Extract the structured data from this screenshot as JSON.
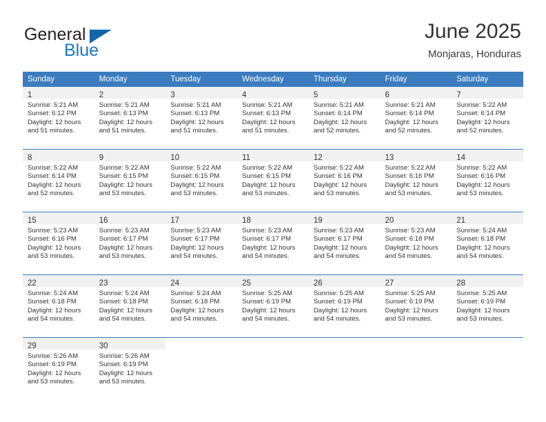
{
  "brand": {
    "name_part1": "General",
    "name_part2": "Blue",
    "triangle_color": "#1565ad",
    "blue_color": "#1b76c4"
  },
  "header": {
    "title": "June 2025",
    "location": "Monjaras, Honduras"
  },
  "theme": {
    "header_bg": "#3a7cbe",
    "daynum_bg": "#f1f1f1",
    "divider": "#3a7cbe",
    "text": "#333333"
  },
  "weekday_headers": [
    "Sunday",
    "Monday",
    "Tuesday",
    "Wednesday",
    "Thursday",
    "Friday",
    "Saturday"
  ],
  "weeks": [
    [
      {
        "day": "1",
        "sunrise": "Sunrise: 5:21 AM",
        "sunset": "Sunset: 6:12 PM",
        "daylight_line1": "Daylight: 12 hours",
        "daylight_line2": "and 51 minutes."
      },
      {
        "day": "2",
        "sunrise": "Sunrise: 5:21 AM",
        "sunset": "Sunset: 6:13 PM",
        "daylight_line1": "Daylight: 12 hours",
        "daylight_line2": "and 51 minutes."
      },
      {
        "day": "3",
        "sunrise": "Sunrise: 5:21 AM",
        "sunset": "Sunset: 6:13 PM",
        "daylight_line1": "Daylight: 12 hours",
        "daylight_line2": "and 51 minutes."
      },
      {
        "day": "4",
        "sunrise": "Sunrise: 5:21 AM",
        "sunset": "Sunset: 6:13 PM",
        "daylight_line1": "Daylight: 12 hours",
        "daylight_line2": "and 51 minutes."
      },
      {
        "day": "5",
        "sunrise": "Sunrise: 5:21 AM",
        "sunset": "Sunset: 6:14 PM",
        "daylight_line1": "Daylight: 12 hours",
        "daylight_line2": "and 52 minutes."
      },
      {
        "day": "6",
        "sunrise": "Sunrise: 5:21 AM",
        "sunset": "Sunset: 6:14 PM",
        "daylight_line1": "Daylight: 12 hours",
        "daylight_line2": "and 52 minutes."
      },
      {
        "day": "7",
        "sunrise": "Sunrise: 5:22 AM",
        "sunset": "Sunset: 6:14 PM",
        "daylight_line1": "Daylight: 12 hours",
        "daylight_line2": "and 52 minutes."
      }
    ],
    [
      {
        "day": "8",
        "sunrise": "Sunrise: 5:22 AM",
        "sunset": "Sunset: 6:14 PM",
        "daylight_line1": "Daylight: 12 hours",
        "daylight_line2": "and 52 minutes."
      },
      {
        "day": "9",
        "sunrise": "Sunrise: 5:22 AM",
        "sunset": "Sunset: 6:15 PM",
        "daylight_line1": "Daylight: 12 hours",
        "daylight_line2": "and 53 minutes."
      },
      {
        "day": "10",
        "sunrise": "Sunrise: 5:22 AM",
        "sunset": "Sunset: 6:15 PM",
        "daylight_line1": "Daylight: 12 hours",
        "daylight_line2": "and 53 minutes."
      },
      {
        "day": "11",
        "sunrise": "Sunrise: 5:22 AM",
        "sunset": "Sunset: 6:15 PM",
        "daylight_line1": "Daylight: 12 hours",
        "daylight_line2": "and 53 minutes."
      },
      {
        "day": "12",
        "sunrise": "Sunrise: 5:22 AM",
        "sunset": "Sunset: 6:16 PM",
        "daylight_line1": "Daylight: 12 hours",
        "daylight_line2": "and 53 minutes."
      },
      {
        "day": "13",
        "sunrise": "Sunrise: 5:22 AM",
        "sunset": "Sunset: 6:16 PM",
        "daylight_line1": "Daylight: 12 hours",
        "daylight_line2": "and 53 minutes."
      },
      {
        "day": "14",
        "sunrise": "Sunrise: 5:22 AM",
        "sunset": "Sunset: 6:16 PM",
        "daylight_line1": "Daylight: 12 hours",
        "daylight_line2": "and 53 minutes."
      }
    ],
    [
      {
        "day": "15",
        "sunrise": "Sunrise: 5:23 AM",
        "sunset": "Sunset: 6:16 PM",
        "daylight_line1": "Daylight: 12 hours",
        "daylight_line2": "and 53 minutes."
      },
      {
        "day": "16",
        "sunrise": "Sunrise: 5:23 AM",
        "sunset": "Sunset: 6:17 PM",
        "daylight_line1": "Daylight: 12 hours",
        "daylight_line2": "and 53 minutes."
      },
      {
        "day": "17",
        "sunrise": "Sunrise: 5:23 AM",
        "sunset": "Sunset: 6:17 PM",
        "daylight_line1": "Daylight: 12 hours",
        "daylight_line2": "and 54 minutes."
      },
      {
        "day": "18",
        "sunrise": "Sunrise: 5:23 AM",
        "sunset": "Sunset: 6:17 PM",
        "daylight_line1": "Daylight: 12 hours",
        "daylight_line2": "and 54 minutes."
      },
      {
        "day": "19",
        "sunrise": "Sunrise: 5:23 AM",
        "sunset": "Sunset: 6:17 PM",
        "daylight_line1": "Daylight: 12 hours",
        "daylight_line2": "and 54 minutes."
      },
      {
        "day": "20",
        "sunrise": "Sunrise: 5:23 AM",
        "sunset": "Sunset: 6:18 PM",
        "daylight_line1": "Daylight: 12 hours",
        "daylight_line2": "and 54 minutes."
      },
      {
        "day": "21",
        "sunrise": "Sunrise: 5:24 AM",
        "sunset": "Sunset: 6:18 PM",
        "daylight_line1": "Daylight: 12 hours",
        "daylight_line2": "and 54 minutes."
      }
    ],
    [
      {
        "day": "22",
        "sunrise": "Sunrise: 5:24 AM",
        "sunset": "Sunset: 6:18 PM",
        "daylight_line1": "Daylight: 12 hours",
        "daylight_line2": "and 54 minutes."
      },
      {
        "day": "23",
        "sunrise": "Sunrise: 5:24 AM",
        "sunset": "Sunset: 6:18 PM",
        "daylight_line1": "Daylight: 12 hours",
        "daylight_line2": "and 54 minutes."
      },
      {
        "day": "24",
        "sunrise": "Sunrise: 5:24 AM",
        "sunset": "Sunset: 6:18 PM",
        "daylight_line1": "Daylight: 12 hours",
        "daylight_line2": "and 54 minutes."
      },
      {
        "day": "25",
        "sunrise": "Sunrise: 5:25 AM",
        "sunset": "Sunset: 6:19 PM",
        "daylight_line1": "Daylight: 12 hours",
        "daylight_line2": "and 54 minutes."
      },
      {
        "day": "26",
        "sunrise": "Sunrise: 5:25 AM",
        "sunset": "Sunset: 6:19 PM",
        "daylight_line1": "Daylight: 12 hours",
        "daylight_line2": "and 54 minutes."
      },
      {
        "day": "27",
        "sunrise": "Sunrise: 5:25 AM",
        "sunset": "Sunset: 6:19 PM",
        "daylight_line1": "Daylight: 12 hours",
        "daylight_line2": "and 53 minutes."
      },
      {
        "day": "28",
        "sunrise": "Sunrise: 5:25 AM",
        "sunset": "Sunset: 6:19 PM",
        "daylight_line1": "Daylight: 12 hours",
        "daylight_line2": "and 53 minutes."
      }
    ],
    [
      {
        "day": "29",
        "sunrise": "Sunrise: 5:26 AM",
        "sunset": "Sunset: 6:19 PM",
        "daylight_line1": "Daylight: 12 hours",
        "daylight_line2": "and 53 minutes."
      },
      {
        "day": "30",
        "sunrise": "Sunrise: 5:26 AM",
        "sunset": "Sunset: 6:19 PM",
        "daylight_line1": "Daylight: 12 hours",
        "daylight_line2": "and 53 minutes."
      },
      null,
      null,
      null,
      null,
      null
    ]
  ]
}
